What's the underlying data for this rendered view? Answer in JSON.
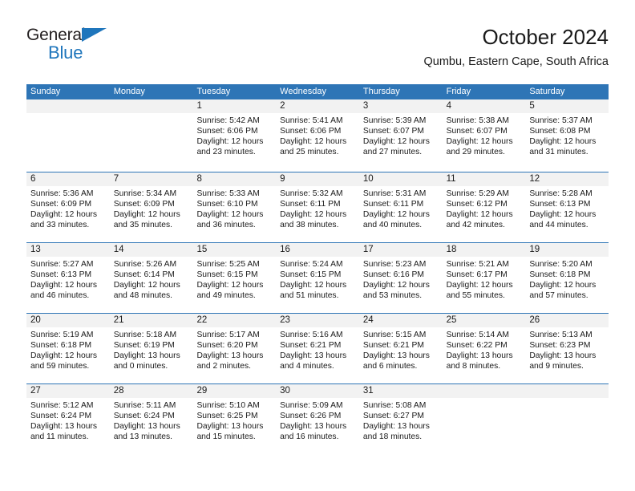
{
  "brand": {
    "name_top": "General",
    "name_bottom": "Blue",
    "accent_color": "#1f76bc",
    "triangle_icon": "triangle-icon"
  },
  "header": {
    "title": "October 2024",
    "location": "Qumbu, Eastern Cape, South Africa"
  },
  "theme": {
    "header_band": "#2e75b6",
    "day_band": "#f2f2f2",
    "text": "#1a1a1a",
    "header_text": "#ffffff"
  },
  "weekdays": [
    "Sunday",
    "Monday",
    "Tuesday",
    "Wednesday",
    "Thursday",
    "Friday",
    "Saturday"
  ],
  "weeks": [
    [
      {
        "day": "",
        "empty": true,
        "lines": []
      },
      {
        "day": "",
        "empty": true,
        "lines": []
      },
      {
        "day": "1",
        "lines": [
          "Sunrise: 5:42 AM",
          "Sunset: 6:06 PM",
          "Daylight: 12 hours",
          "and 23 minutes."
        ]
      },
      {
        "day": "2",
        "lines": [
          "Sunrise: 5:41 AM",
          "Sunset: 6:06 PM",
          "Daylight: 12 hours",
          "and 25 minutes."
        ]
      },
      {
        "day": "3",
        "lines": [
          "Sunrise: 5:39 AM",
          "Sunset: 6:07 PM",
          "Daylight: 12 hours",
          "and 27 minutes."
        ]
      },
      {
        "day": "4",
        "lines": [
          "Sunrise: 5:38 AM",
          "Sunset: 6:07 PM",
          "Daylight: 12 hours",
          "and 29 minutes."
        ]
      },
      {
        "day": "5",
        "lines": [
          "Sunrise: 5:37 AM",
          "Sunset: 6:08 PM",
          "Daylight: 12 hours",
          "and 31 minutes."
        ]
      }
    ],
    [
      {
        "day": "6",
        "lines": [
          "Sunrise: 5:36 AM",
          "Sunset: 6:09 PM",
          "Daylight: 12 hours",
          "and 33 minutes."
        ]
      },
      {
        "day": "7",
        "lines": [
          "Sunrise: 5:34 AM",
          "Sunset: 6:09 PM",
          "Daylight: 12 hours",
          "and 35 minutes."
        ]
      },
      {
        "day": "8",
        "lines": [
          "Sunrise: 5:33 AM",
          "Sunset: 6:10 PM",
          "Daylight: 12 hours",
          "and 36 minutes."
        ]
      },
      {
        "day": "9",
        "lines": [
          "Sunrise: 5:32 AM",
          "Sunset: 6:11 PM",
          "Daylight: 12 hours",
          "and 38 minutes."
        ]
      },
      {
        "day": "10",
        "lines": [
          "Sunrise: 5:31 AM",
          "Sunset: 6:11 PM",
          "Daylight: 12 hours",
          "and 40 minutes."
        ]
      },
      {
        "day": "11",
        "lines": [
          "Sunrise: 5:29 AM",
          "Sunset: 6:12 PM",
          "Daylight: 12 hours",
          "and 42 minutes."
        ]
      },
      {
        "day": "12",
        "lines": [
          "Sunrise: 5:28 AM",
          "Sunset: 6:13 PM",
          "Daylight: 12 hours",
          "and 44 minutes."
        ]
      }
    ],
    [
      {
        "day": "13",
        "lines": [
          "Sunrise: 5:27 AM",
          "Sunset: 6:13 PM",
          "Daylight: 12 hours",
          "and 46 minutes."
        ]
      },
      {
        "day": "14",
        "lines": [
          "Sunrise: 5:26 AM",
          "Sunset: 6:14 PM",
          "Daylight: 12 hours",
          "and 48 minutes."
        ]
      },
      {
        "day": "15",
        "lines": [
          "Sunrise: 5:25 AM",
          "Sunset: 6:15 PM",
          "Daylight: 12 hours",
          "and 49 minutes."
        ]
      },
      {
        "day": "16",
        "lines": [
          "Sunrise: 5:24 AM",
          "Sunset: 6:15 PM",
          "Daylight: 12 hours",
          "and 51 minutes."
        ]
      },
      {
        "day": "17",
        "lines": [
          "Sunrise: 5:23 AM",
          "Sunset: 6:16 PM",
          "Daylight: 12 hours",
          "and 53 minutes."
        ]
      },
      {
        "day": "18",
        "lines": [
          "Sunrise: 5:21 AM",
          "Sunset: 6:17 PM",
          "Daylight: 12 hours",
          "and 55 minutes."
        ]
      },
      {
        "day": "19",
        "lines": [
          "Sunrise: 5:20 AM",
          "Sunset: 6:18 PM",
          "Daylight: 12 hours",
          "and 57 minutes."
        ]
      }
    ],
    [
      {
        "day": "20",
        "lines": [
          "Sunrise: 5:19 AM",
          "Sunset: 6:18 PM",
          "Daylight: 12 hours",
          "and 59 minutes."
        ]
      },
      {
        "day": "21",
        "lines": [
          "Sunrise: 5:18 AM",
          "Sunset: 6:19 PM",
          "Daylight: 13 hours",
          "and 0 minutes."
        ]
      },
      {
        "day": "22",
        "lines": [
          "Sunrise: 5:17 AM",
          "Sunset: 6:20 PM",
          "Daylight: 13 hours",
          "and 2 minutes."
        ]
      },
      {
        "day": "23",
        "lines": [
          "Sunrise: 5:16 AM",
          "Sunset: 6:21 PM",
          "Daylight: 13 hours",
          "and 4 minutes."
        ]
      },
      {
        "day": "24",
        "lines": [
          "Sunrise: 5:15 AM",
          "Sunset: 6:21 PM",
          "Daylight: 13 hours",
          "and 6 minutes."
        ]
      },
      {
        "day": "25",
        "lines": [
          "Sunrise: 5:14 AM",
          "Sunset: 6:22 PM",
          "Daylight: 13 hours",
          "and 8 minutes."
        ]
      },
      {
        "day": "26",
        "lines": [
          "Sunrise: 5:13 AM",
          "Sunset: 6:23 PM",
          "Daylight: 13 hours",
          "and 9 minutes."
        ]
      }
    ],
    [
      {
        "day": "27",
        "lines": [
          "Sunrise: 5:12 AM",
          "Sunset: 6:24 PM",
          "Daylight: 13 hours",
          "and 11 minutes."
        ]
      },
      {
        "day": "28",
        "lines": [
          "Sunrise: 5:11 AM",
          "Sunset: 6:24 PM",
          "Daylight: 13 hours",
          "and 13 minutes."
        ]
      },
      {
        "day": "29",
        "lines": [
          "Sunrise: 5:10 AM",
          "Sunset: 6:25 PM",
          "Daylight: 13 hours",
          "and 15 minutes."
        ]
      },
      {
        "day": "30",
        "lines": [
          "Sunrise: 5:09 AM",
          "Sunset: 6:26 PM",
          "Daylight: 13 hours",
          "and 16 minutes."
        ]
      },
      {
        "day": "31",
        "lines": [
          "Sunrise: 5:08 AM",
          "Sunset: 6:27 PM",
          "Daylight: 13 hours",
          "and 18 minutes."
        ]
      },
      {
        "day": "",
        "empty": true,
        "lines": []
      },
      {
        "day": "",
        "empty": true,
        "lines": []
      }
    ]
  ]
}
